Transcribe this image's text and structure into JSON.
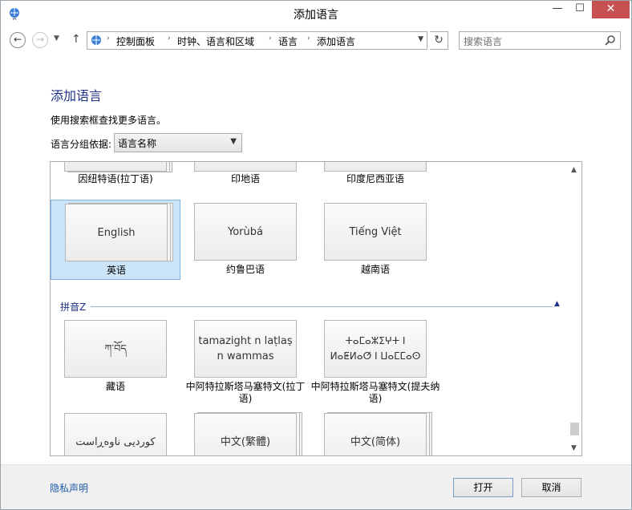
{
  "window": {
    "title": "添加语言",
    "minimize": "—",
    "maximize": "☐",
    "close": "✕"
  },
  "address_bar": {
    "breadcrumbs": [
      "控制面板",
      "时钟、语言和区域",
      "语言",
      "添加语言"
    ],
    "search_placeholder": "搜索语言"
  },
  "content": {
    "heading": "添加语言",
    "hint": "使用搜索框查找更多语言。",
    "group_by_label": "语言分组依据:",
    "group_by_value": "语言名称"
  },
  "language_list": {
    "partial_row": [
      {
        "name": "因纽特语(拉丁语)"
      },
      {
        "name": "印地语"
      },
      {
        "name": "印度尼西亚语"
      }
    ],
    "row_y_tiles": [
      {
        "native": "English",
        "name": "英语",
        "selected": true
      },
      {
        "native": "Yorùbá",
        "name": "约鲁巴语",
        "selected": false
      },
      {
        "native": "Tiếng Việt",
        "name": "越南语",
        "selected": false
      }
    ],
    "section_z": {
      "header": "拼音Z",
      "tiles": [
        {
          "native": "ཀ་བོད",
          "name": "藏语"
        },
        {
          "native": "tamazight n laṭlaṣ n wammas",
          "name": "中阿特拉斯塔马塞特文(拉丁语)"
        },
        {
          "native": "ⵜⴰⵎⴰⵣⵉⵖⵜ ⵏ ⵍⴰⵟⵍⴰⵚ ⵏ ⵡⴰⵎⵎⴰⵙ",
          "name": "中阿特拉斯塔马塞特文(提夫纳语)"
        }
      ],
      "bottom_tiles": [
        {
          "native": "کوردیی ناوەڕاست"
        },
        {
          "native": "中文(繁體)"
        },
        {
          "native": "中文(简体)"
        }
      ]
    }
  },
  "footer": {
    "privacy_link": "隐私声明",
    "open_button": "打开",
    "cancel_button": "取消"
  }
}
